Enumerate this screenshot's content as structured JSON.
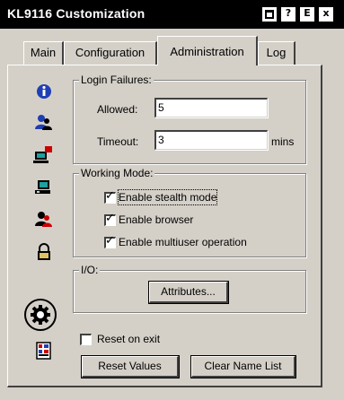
{
  "window": {
    "title": "KL9116 Customization",
    "icons": [
      "minimize-icon",
      "help-icon",
      "export-icon",
      "close-icon"
    ],
    "help_glyph": "?",
    "export_glyph": "E",
    "close_glyph": "x"
  },
  "tabs": [
    {
      "label": "Main",
      "active": false
    },
    {
      "label": "Configuration",
      "active": false
    },
    {
      "label": "Administration",
      "active": true
    },
    {
      "label": "Log",
      "active": false
    }
  ],
  "sidebar_icons": [
    "info-icon",
    "user-icon",
    "computer-alert-icon",
    "computer-icon",
    "user-alert-icon",
    "lock-icon",
    "gear-icon",
    "checklist-icon"
  ],
  "login_failures": {
    "legend": "Login Failures:",
    "allowed_label": "Allowed:",
    "allowed_value": "5",
    "timeout_label": "Timeout:",
    "timeout_value": "3",
    "timeout_unit": "mins"
  },
  "working_mode": {
    "legend": "Working Mode:",
    "options": [
      {
        "label": "Enable stealth mode",
        "checked": true
      },
      {
        "label": "Enable browser",
        "checked": true
      },
      {
        "label": "Enable multiuser operation",
        "checked": true
      }
    ]
  },
  "io": {
    "legend": "I/O:",
    "attributes_button": "Attributes..."
  },
  "reset_on_exit": {
    "label": "Reset on exit",
    "checked": false
  },
  "buttons": {
    "reset_values": "Reset Values",
    "clear_name_list": "Clear Name List"
  },
  "check_glyph": "✓",
  "colors": {
    "title_bar": "#000000",
    "dialog": "#d4d0c8",
    "info_blue": "#1f3fb4",
    "user_blue": "#1f3fb4",
    "alert_red": "#cc0000"
  }
}
